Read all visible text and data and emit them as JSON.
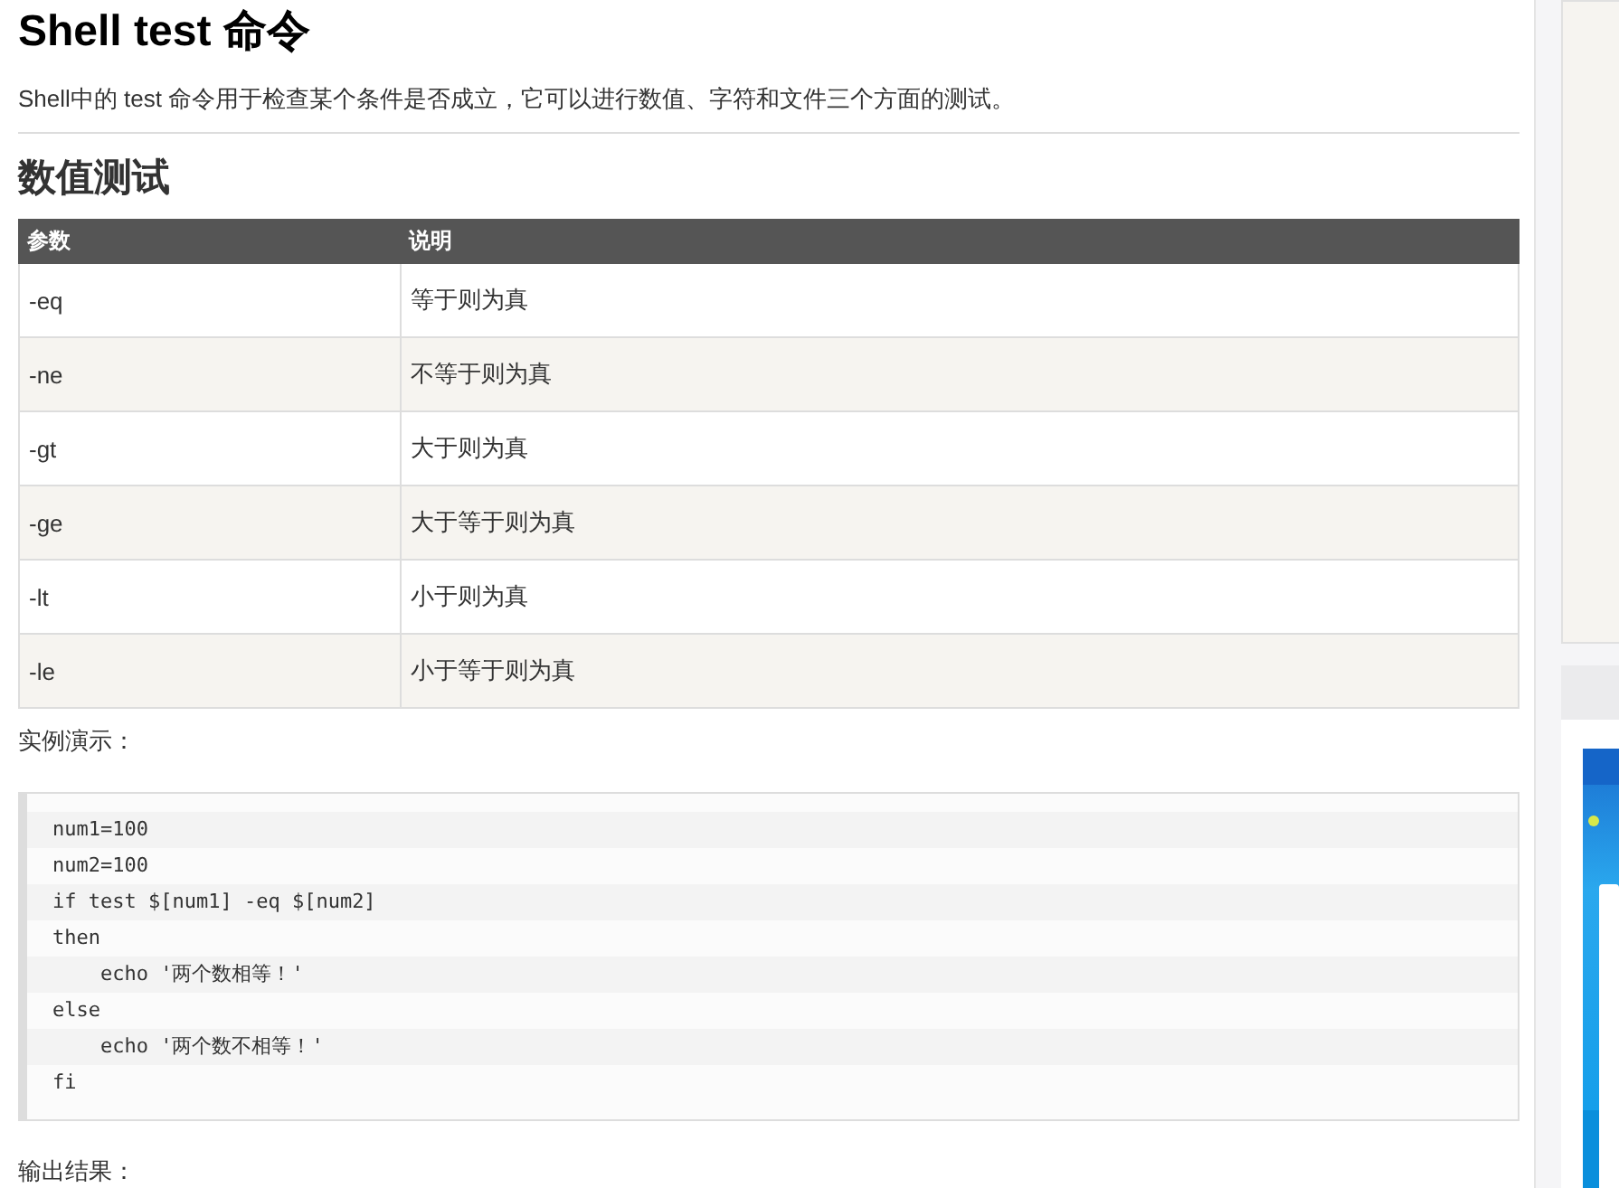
{
  "title": "Shell test 命令",
  "intro": "Shell中的 test 命令用于检查某个条件是否成立，它可以进行数值、字符和文件三个方面的测试。",
  "section_title": "数值测试",
  "table": {
    "columns": [
      "参数",
      "说明"
    ],
    "rows": [
      {
        "cells": [
          "-eq",
          "等于则为真"
        ]
      },
      {
        "cells": [
          "-ne",
          "不等于则为真"
        ]
      },
      {
        "cells": [
          "-gt",
          "大于则为真"
        ]
      },
      {
        "cells": [
          "-ge",
          "大于等于则为真"
        ]
      },
      {
        "cells": [
          "-lt",
          "小于则为真"
        ]
      },
      {
        "cells": [
          "-le",
          "小于等于则为真"
        ]
      }
    ]
  },
  "example_label": "实例演示：",
  "code_lines": [
    "num1=100",
    "num2=100",
    "if test $[num1] -eq $[num2]",
    "then",
    "    echo '两个数相等！'",
    "else",
    "    echo '两个数不相等！'",
    "fi"
  ],
  "output_label": "输出结果："
}
